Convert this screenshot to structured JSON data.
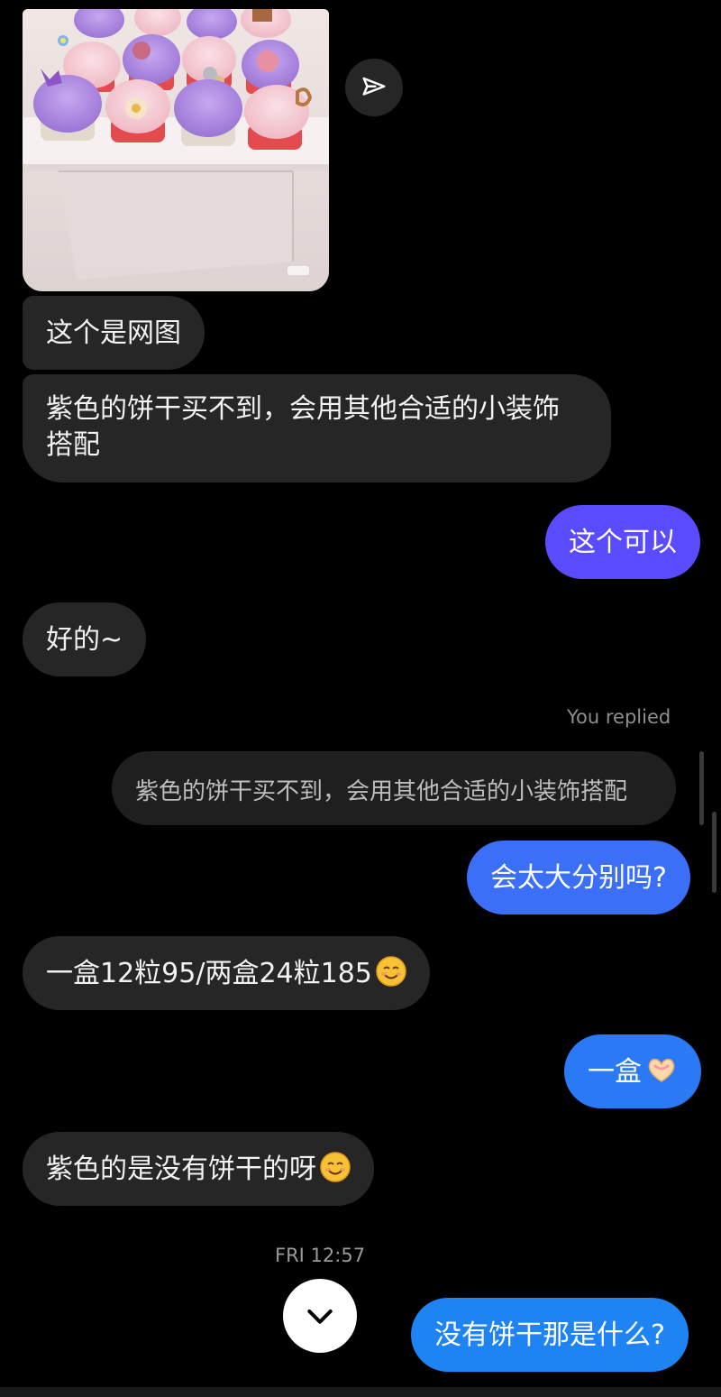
{
  "messages": {
    "m1": "这个是网图",
    "m2_line1": "紫色的饼干买不到，会用其他合适的小装饰",
    "m2_line2": "搭配",
    "m3": "这个可以",
    "m4": "好的~",
    "reply_label": "You replied",
    "reply_quote": "紫色的饼干买不到，会用其他合适的小装饰搭配",
    "m5": "会太大分别吗?",
    "m6": "一盒12粒95/两盒24粒185",
    "m7": "一盒",
    "m8": "紫色的是没有饼干的呀",
    "timestamp": "FRI 12:57",
    "m9": "没有饼干那是什么?"
  },
  "image": {
    "watermark": "小红书"
  },
  "colors": {
    "incoming_bubble": "#262626",
    "outgoing_purple": "#5b4bff",
    "outgoing_blue": "#3c6ff7",
    "outgoing_blue2": "#1f84f3",
    "background": "#000000"
  },
  "icons": {
    "share": "send-icon",
    "scroll_down": "chevron-down-icon",
    "emoji_smile": "smiling-face-emoji",
    "emoji_heart_hands": "heart-hands-emoji"
  }
}
